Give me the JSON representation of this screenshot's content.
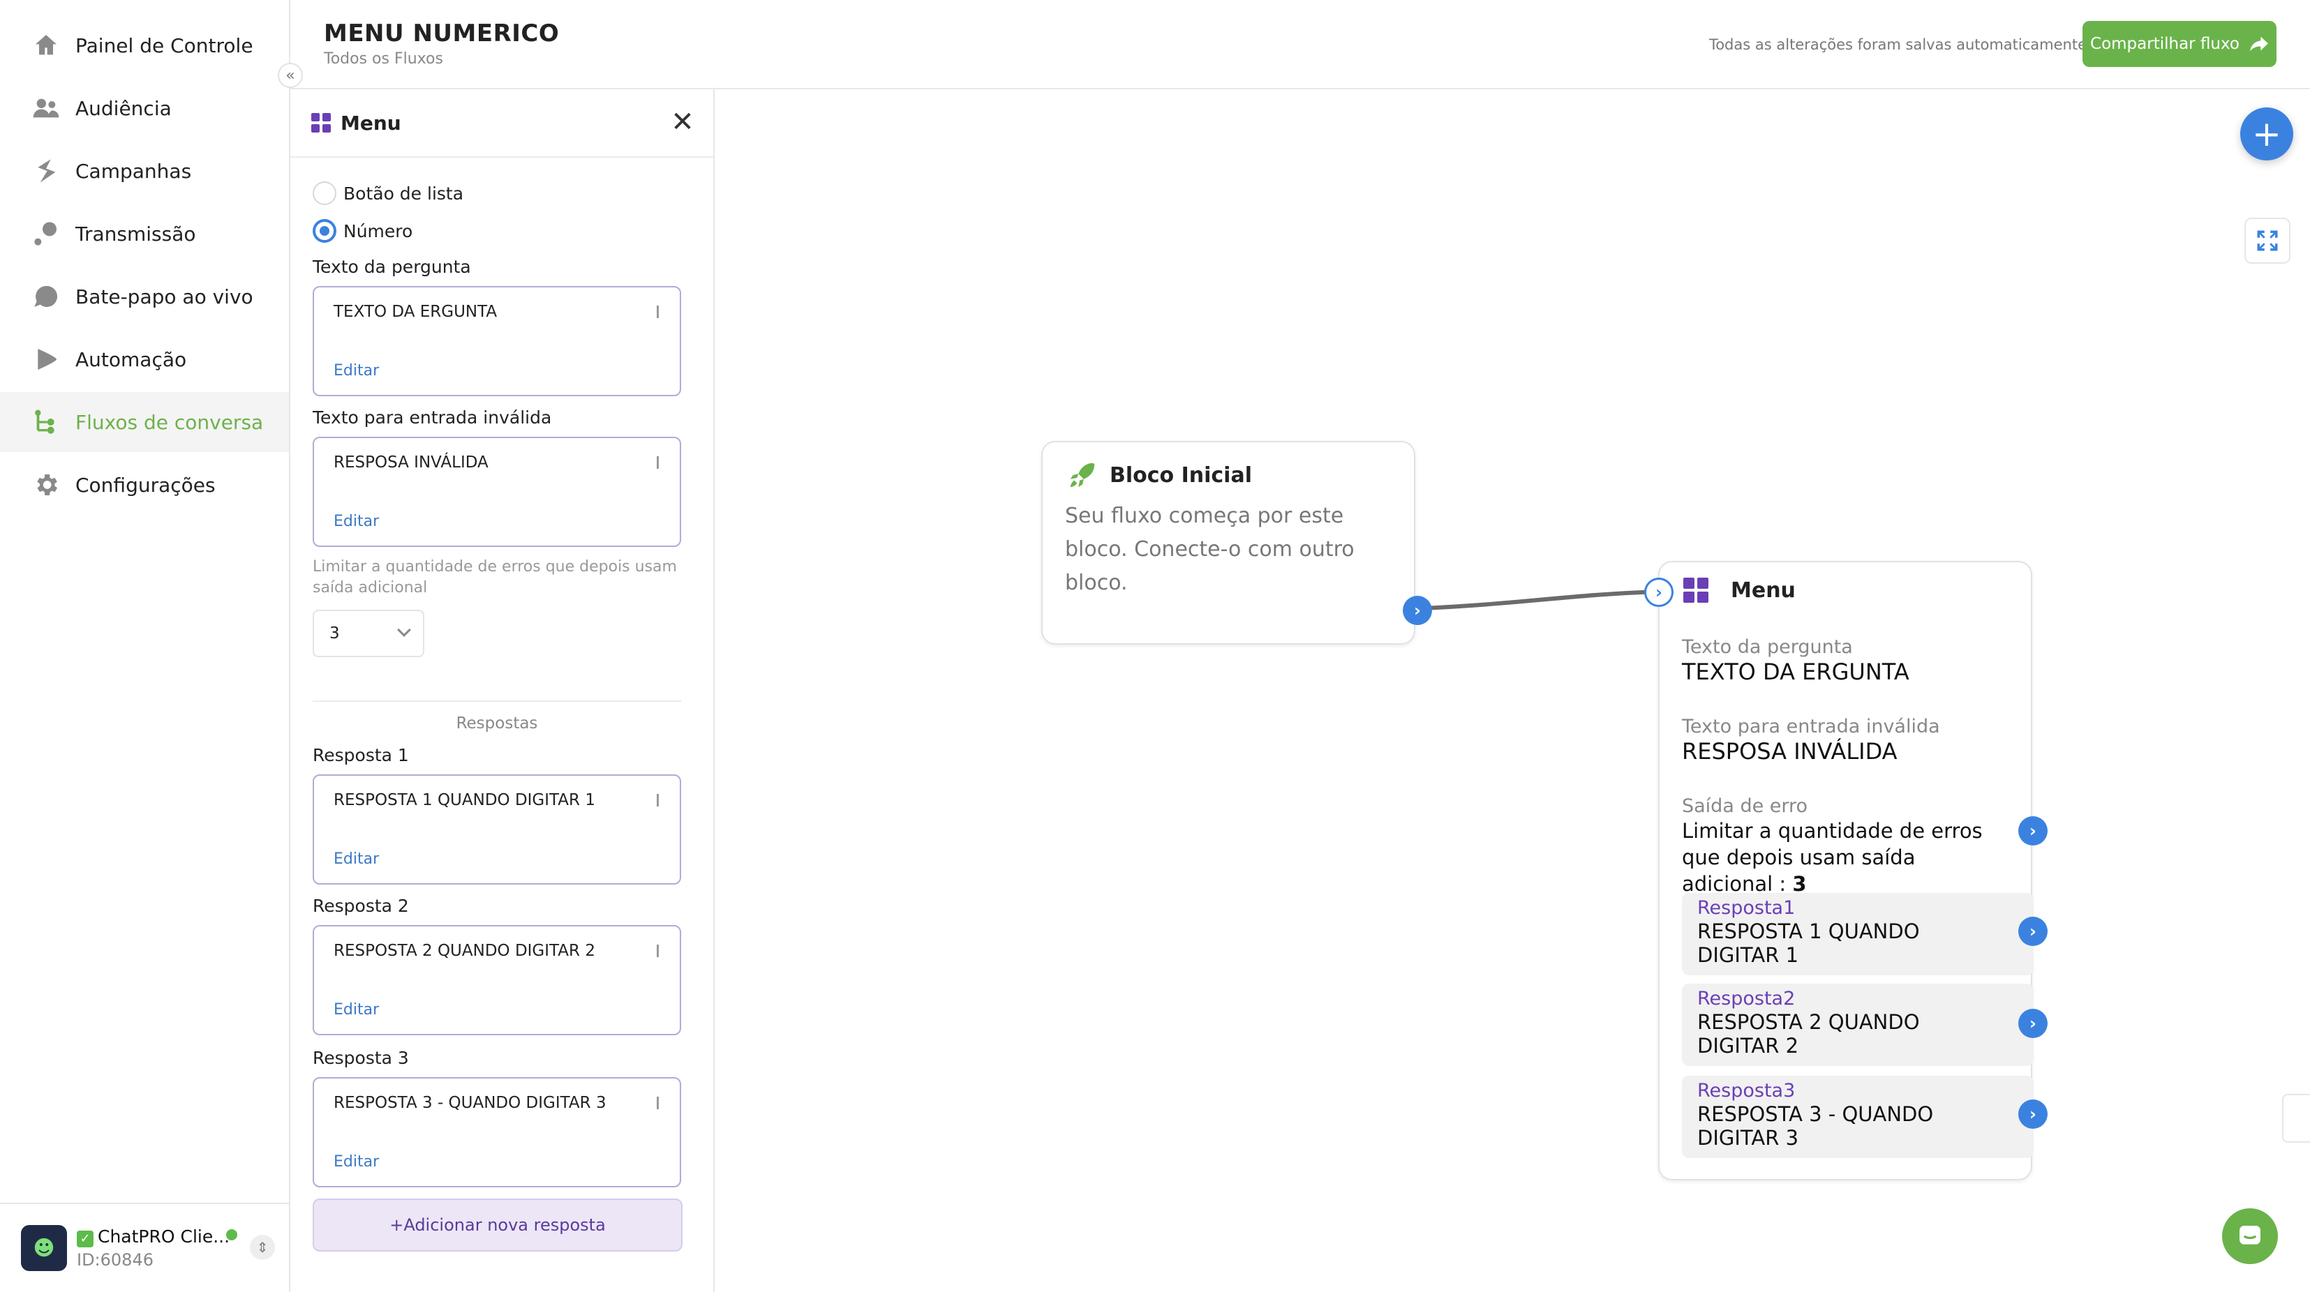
{
  "sidebar": {
    "items": [
      {
        "label": "Painel de Controle",
        "icon": "home-icon"
      },
      {
        "label": "Audiência",
        "icon": "users-icon"
      },
      {
        "label": "Campanhas",
        "icon": "campaign-icon"
      },
      {
        "label": "Transmissão",
        "icon": "broadcast-icon"
      },
      {
        "label": "Bate-papo ao vivo",
        "icon": "chat-icon"
      },
      {
        "label": "Automação",
        "icon": "automation-icon"
      },
      {
        "label": "Fluxos de conversa",
        "icon": "flow-icon",
        "active": true
      },
      {
        "label": "Configurações",
        "icon": "gear-icon"
      }
    ],
    "account": {
      "avatar_text": "☻",
      "name": "ChatPRO Clie...",
      "id": "ID:60846"
    }
  },
  "header": {
    "title": "MENU NUMERICO",
    "breadcrumb": "Todos os Fluxos",
    "autosave": "Todas as alterações foram salvas automaticamente",
    "share_label": "Compartilhar fluxo"
  },
  "panel": {
    "title": "Menu",
    "options": [
      {
        "label": "Botão de lista",
        "checked": false
      },
      {
        "label": "Número",
        "checked": true
      }
    ],
    "question_label": "Texto da pergunta",
    "question_value": "TEXTO DA ERGUNTA",
    "invalid_label": "Texto para entrada inválida",
    "invalid_value": "RESPOSA INVÁLIDA",
    "edit_label": "Editar",
    "error_hint": "Limitar a quantidade de erros que depois usam saída adicional",
    "error_limit": "3",
    "answers_section": "Respostas",
    "answers": [
      {
        "label": "Resposta 1",
        "value": "RESPOSTA 1 QUANDO DIGITAR 1"
      },
      {
        "label": "Resposta 2",
        "value": "RESPOSTA 2 QUANDO DIGITAR 2"
      },
      {
        "label": "Resposta 3",
        "value": "RESPOSTA 3 - QUANDO DIGITAR 3"
      }
    ],
    "add_label": "+Adicionar nova resposta"
  },
  "canvas": {
    "start_node": {
      "title": "Bloco Inicial",
      "description": "Seu fluxo começa por este bloco. Conecte-o com outro bloco."
    },
    "menu_node": {
      "title": "Menu",
      "question_label": "Texto da pergunta",
      "question_value": "TEXTO DA ERGUNTA",
      "invalid_label": "Texto para entrada inválida",
      "invalid_value": "RESPOSA INVÁLIDA",
      "error_label": "Saída de erro",
      "error_text": "Limitar a quantidade de erros que depois usam saída adicional : ",
      "error_value": "3",
      "answers": [
        {
          "label": "Resposta1",
          "value": "RESPOSTA 1 QUANDO DIGITAR 1"
        },
        {
          "label": "Resposta2",
          "value": "RESPOSTA 2 QUANDO DIGITAR 2"
        },
        {
          "label": "Resposta3",
          "value": "RESPOSTA 3 - QUANDO DIGITAR 3"
        }
      ]
    }
  },
  "colors": {
    "accent_green": "#6ab34a",
    "accent_blue": "#3b82e0",
    "accent_purple": "#6a3fb5"
  }
}
